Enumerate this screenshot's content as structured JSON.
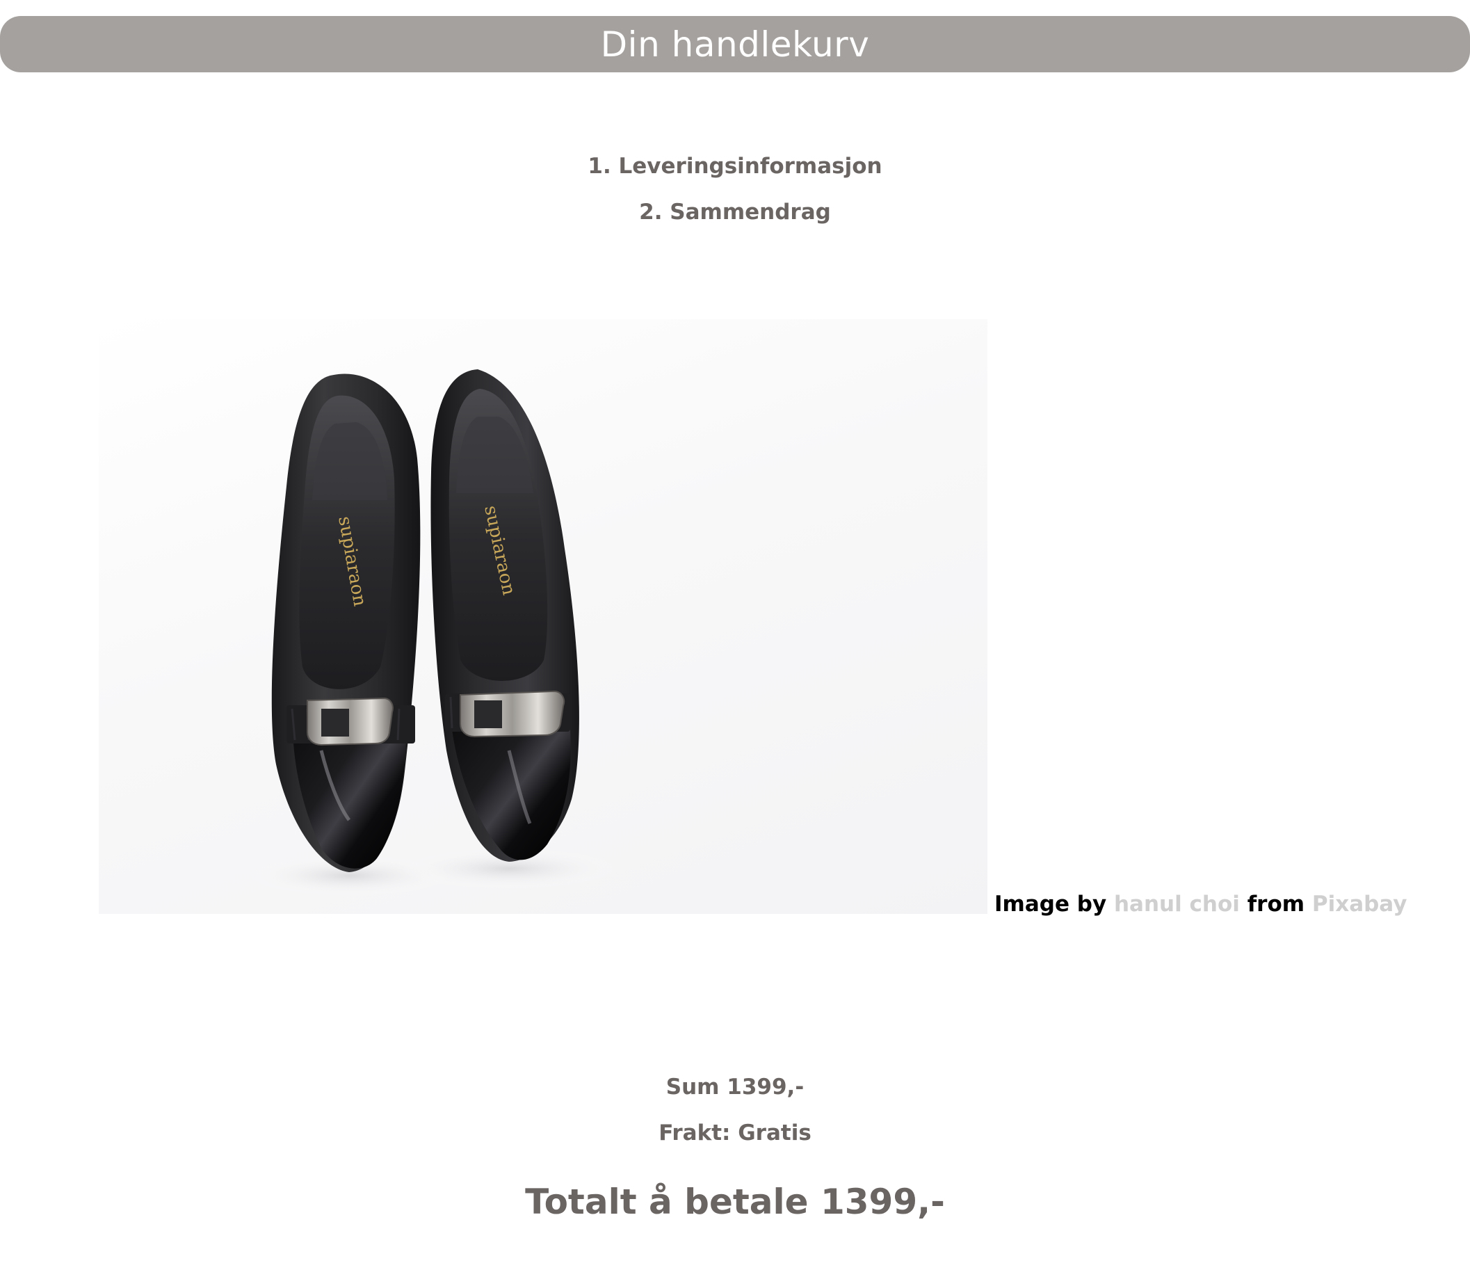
{
  "header": {
    "title": "Din handlekurv"
  },
  "steps": [
    {
      "label": "1. Leveringsinformasjon"
    },
    {
      "label": "2. Sammendrag"
    }
  ],
  "product": {
    "image_alt": "Black pointed-toe pumps with silver buckle",
    "insole_brand": "supiaraon"
  },
  "credit": {
    "prefix": "Image by",
    "author": "hanul choi",
    "middle": "from",
    "source": "Pixabay"
  },
  "summary": {
    "sum": "Sum 1399,-",
    "shipping": "Frakt: Gratis",
    "total": "Totalt å betale 1399,-"
  },
  "colors": {
    "header_bg": "#a4a19e",
    "text_muted": "#6a6462",
    "link": "#cfcfcf"
  }
}
